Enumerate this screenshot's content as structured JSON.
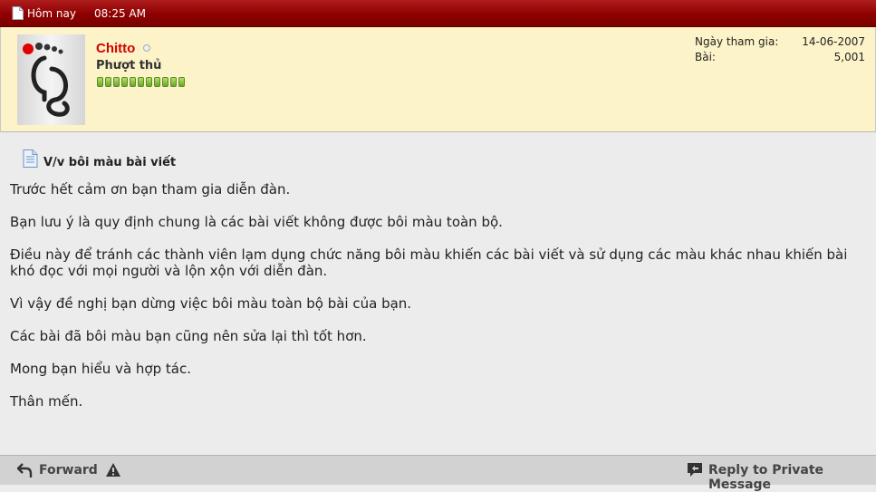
{
  "header": {
    "date": "Hôm nay",
    "time": "08:25 AM",
    "icon": "document-icon"
  },
  "user": {
    "name": "Chitto",
    "title": "Phượt thủ",
    "reputation_pips": 11,
    "online_status_icon": "offline-dot-icon",
    "stats": [
      {
        "label": "Ngày tham gia:",
        "value": "14-06-2007"
      },
      {
        "label": "Bài:",
        "value": "5,001"
      }
    ]
  },
  "post": {
    "title": "V/v bôi màu bài viết",
    "paragraphs": [
      "Trước hết cảm ơn bạn tham gia diễn đàn.",
      "Bạn lưu ý là quy định chung là các bài viết không được bôi màu toàn bộ.",
      "Điều này để tránh các thành viên lạm dụng chức năng bôi màu khiến các bài viết và sử dụng các màu khác nhau khiến bài khó đọc với mọi người và lộn xộn với diễn đàn.",
      "Vì vậy đề nghị bạn dừng việc bôi màu toàn bộ bài của bạn.",
      "Các bài đã bôi màu bạn cũng nên sửa lại thì tốt hơn.",
      "Mong bạn hiểu và hợp tác.",
      "Thân mến."
    ]
  },
  "footer": {
    "forward_label": "Forward",
    "reply_label": "Reply to Private Message"
  },
  "colors": {
    "header_red": "#8e0000",
    "userinfo_bg": "#fdf3c8",
    "username_red": "#d40000",
    "reputation_green": "#6ca52a"
  }
}
